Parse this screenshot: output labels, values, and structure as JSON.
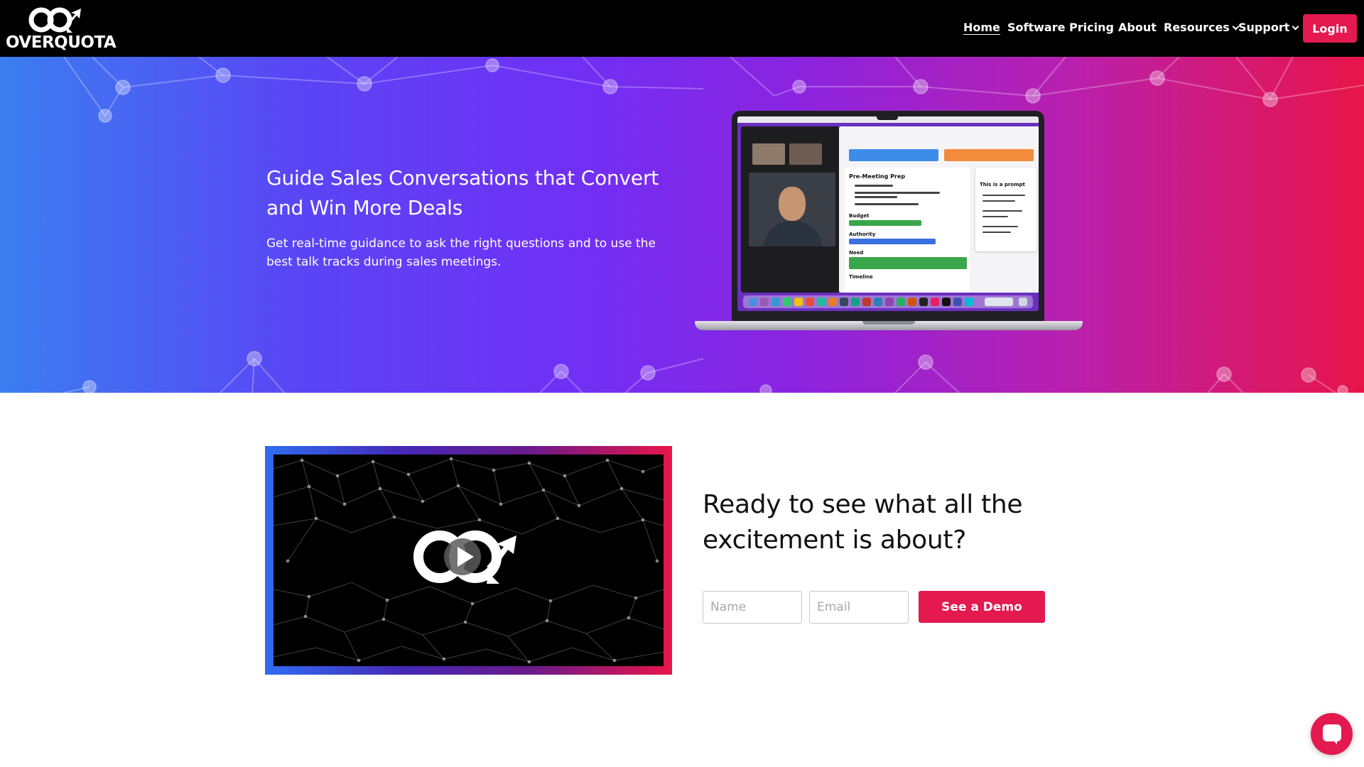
{
  "brand": {
    "name": "OverQuota",
    "logo_text": "OVERQUOTA",
    "accent_color": "#e3194f"
  },
  "nav": {
    "items": [
      {
        "label": "Home",
        "active": true,
        "dropdown": false
      },
      {
        "label": "Software",
        "active": false,
        "dropdown": false
      },
      {
        "label": "Pricing",
        "active": false,
        "dropdown": false
      },
      {
        "label": "About",
        "active": false,
        "dropdown": false
      },
      {
        "label": "Resources",
        "active": false,
        "dropdown": true
      },
      {
        "label": "Support",
        "active": false,
        "dropdown": true
      }
    ],
    "login_label": "Login"
  },
  "hero": {
    "title": "Guide Sales Conversations that Convert and Win More Deals",
    "subtitle": "Get real-time guidance to ask the right questions and to use the best talk tracks during sales meetings.",
    "gradient_colors": [
      "#3b7ef0",
      "#7030f5",
      "#e8154a"
    ],
    "laptop_screen": {
      "panel_heading": "Pre-Meeting Prep",
      "sections": [
        "Budget",
        "Authority",
        "Need",
        "Timeline"
      ],
      "side_panel_heading": "This is a prompt"
    }
  },
  "video": {
    "icon": "play-icon"
  },
  "cta": {
    "title": "Ready to see what all the excitement is about?",
    "name_placeholder": "Name",
    "email_placeholder": "Email",
    "button_label": "See a Demo"
  },
  "chat": {
    "icon": "chat-icon"
  }
}
